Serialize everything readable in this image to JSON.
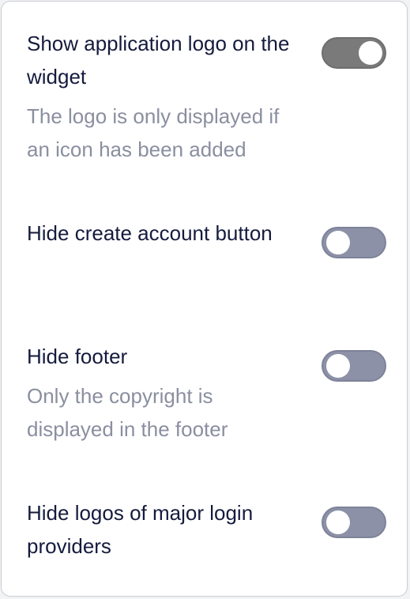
{
  "settings": [
    {
      "label": "Show application logo on the widget",
      "description": "The logo is only displayed if an icon has been added",
      "enabled": true
    },
    {
      "label": "Hide create account button",
      "description": "",
      "enabled": false
    },
    {
      "label": "Hide footer",
      "description": "Only the copyright is displayed in the footer",
      "enabled": false
    },
    {
      "label": "Hide logos of major login providers",
      "description": "",
      "enabled": false
    }
  ],
  "colors": {
    "card_background": "#ffffff",
    "label_text": "#151b3d",
    "description_text": "#8a8fa0",
    "toggle_on": "#7a7a7a",
    "toggle_off": "#8c91a8",
    "toggle_knob": "#ffffff"
  }
}
